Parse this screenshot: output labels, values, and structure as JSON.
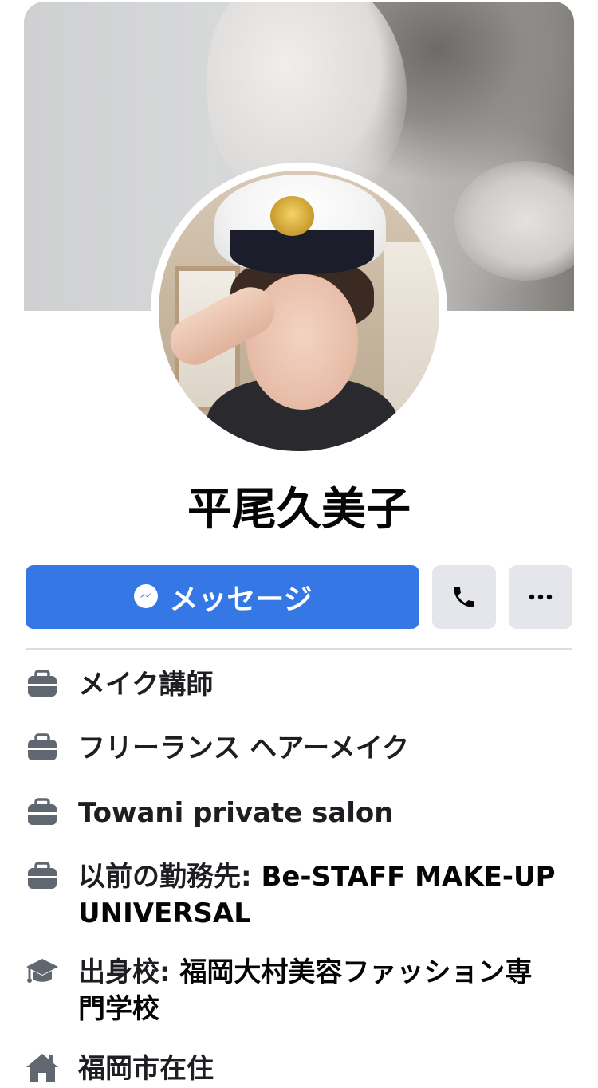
{
  "profile": {
    "name": "平尾久美子"
  },
  "actions": {
    "message_label": "メッセージ",
    "call_icon": "phone-icon",
    "more_icon": "ellipsis-icon"
  },
  "colors": {
    "primary": "#3578E5",
    "secondary_button": "#E4E6EB",
    "icon_gray": "#606770"
  },
  "details": [
    {
      "icon": "briefcase-icon",
      "text": "メイク講師"
    },
    {
      "icon": "briefcase-icon",
      "text": "フリーランス ヘアーメイク"
    },
    {
      "icon": "briefcase-icon",
      "text": "Towani  private salon"
    },
    {
      "icon": "briefcase-icon",
      "prefix": "以前の勤務先: ",
      "value": "Be-STAFF MAKE-UP UNIVERSAL"
    },
    {
      "icon": "graduation-cap-icon",
      "prefix": "出身校: ",
      "value": "福岡大村美容ファッション専門学校"
    },
    {
      "icon": "home-icon",
      "text": "福岡市在住"
    }
  ]
}
